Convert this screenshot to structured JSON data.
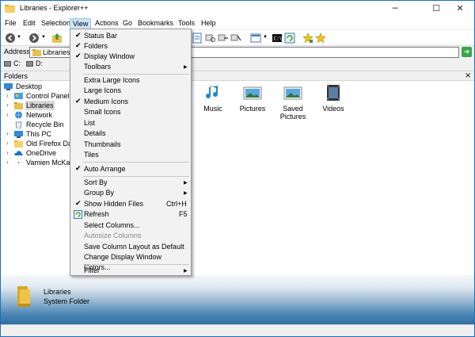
{
  "window": {
    "title": "Libraries - Explorer++"
  },
  "caption": {
    "minimize": "─",
    "maximize": "☐",
    "close": "✕"
  },
  "menubar": [
    {
      "label": "File"
    },
    {
      "label": "Edit"
    },
    {
      "label": "Selection"
    },
    {
      "label": "View"
    },
    {
      "label": "Actions"
    },
    {
      "label": "Go"
    },
    {
      "label": "Bookmarks"
    },
    {
      "label": "Tools"
    },
    {
      "label": "Help"
    }
  ],
  "address": {
    "label": "Address",
    "value": "Libraries",
    "go": "➜"
  },
  "drives": [
    {
      "label": "C:"
    },
    {
      "label": "D:"
    }
  ],
  "folders_pane": {
    "title": "Folders",
    "close": "×"
  },
  "tree": [
    {
      "label": "Desktop",
      "icon": "desktop-icon"
    },
    {
      "label": "Control Panel",
      "icon": "control-panel-icon",
      "expander": "›"
    },
    {
      "label": "Libraries",
      "icon": "library-folder-icon",
      "expander": "›"
    },
    {
      "label": "Network",
      "icon": "network-icon",
      "expander": "›"
    },
    {
      "label": "Recycle Bin",
      "icon": "recycle-bin-icon"
    },
    {
      "label": "This PC",
      "icon": "this-pc-icon",
      "expander": "›"
    },
    {
      "label": "Old Firefox Data",
      "icon": "folder-icon",
      "expander": "›"
    },
    {
      "label": "OneDrive",
      "icon": "onedrive-icon",
      "expander": "›"
    },
    {
      "label": "Vamien McKalin",
      "icon": "user-folder-icon",
      "expander": "›"
    }
  ],
  "files": [
    {
      "label": "Music",
      "icon": "music-library-icon"
    },
    {
      "label": "Pictures",
      "icon": "pictures-library-icon"
    },
    {
      "label": "Saved Pictures",
      "icon": "saved-pictures-library-icon"
    },
    {
      "label": "Videos",
      "icon": "videos-library-icon"
    }
  ],
  "view_menu": {
    "status_bar": "Status Bar",
    "folders": "Folders",
    "display_window": "Display Window",
    "toolbars": "Toolbars",
    "extra_large_icons": "Extra Large Icons",
    "large_icons": "Large Icons",
    "medium_icons": "Medium Icons",
    "small_icons": "Small Icons",
    "list": "List",
    "details": "Details",
    "thumbnails": "Thumbnails",
    "tiles": "Tiles",
    "auto_arrange": "Auto Arrange",
    "sort_by": "Sort By",
    "group_by": "Group By",
    "show_hidden_files": "Show Hidden Files",
    "show_hidden_files_shortcut": "Ctrl+H",
    "refresh": "Refresh",
    "refresh_shortcut": "F5",
    "select_columns": "Select Columns...",
    "autosize_columns": "Autosize Columns",
    "save_column_layout": "Save Column Layout as Default",
    "change_display_window_colors": "Change Display Window Colors...",
    "filter": "Filter",
    "check_mark": "✔",
    "submenu_arrow": "▶"
  },
  "details_pane": {
    "name": "Libraries",
    "type": "System Folder"
  },
  "colors": {
    "accent": "#1c6fb8",
    "menu_highlight": "#cce4f7",
    "selected_tree": "#d9d9d9"
  }
}
